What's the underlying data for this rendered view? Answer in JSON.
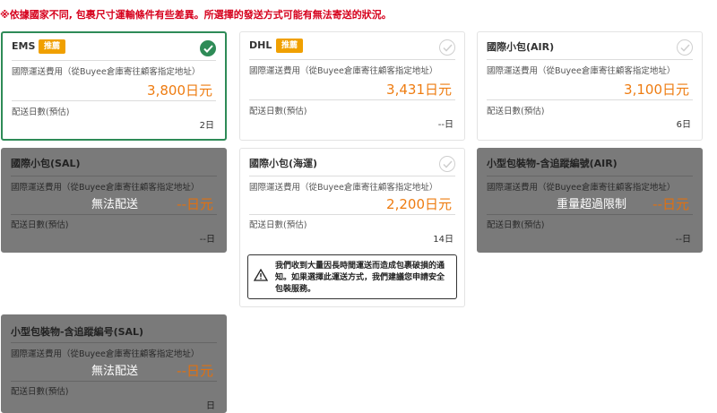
{
  "notice": "※依據國家不同, 包裹尺寸運輸條件有些差異。所選擇的發送方式可能有無法寄送的狀況。",
  "labels": {
    "cost": "國際運送費用（從Buyee倉庫寄往顧客指定地址）",
    "days": "配送日數(預估)"
  },
  "cards": [
    {
      "title": "EMS",
      "badge": "推薦",
      "price": "3,800日元",
      "days": "2日",
      "state": "selected"
    },
    {
      "title": "DHL",
      "badge": "推薦",
      "price": "3,431日元",
      "days": "--日",
      "state": "available"
    },
    {
      "title": "國際小包(AIR)",
      "price": "3,100日元",
      "days": "6日",
      "state": "available"
    },
    {
      "title": "國際小包(SAL)",
      "price": "--日元",
      "days": "--日",
      "status": "無法配送",
      "state": "disabled"
    },
    {
      "title": "國際小包(海運)",
      "price": "2,200日元",
      "days": "14日",
      "state": "available",
      "warning": "我們收到大量因長時間運送而造成包裹破損的通知。如果選擇此運送方式，我們建議您申請安全包裝服務。"
    },
    {
      "title": "小型包裝物-含追蹤編號(AIR)",
      "price": "--日元",
      "days": "--日",
      "status": "重量超過限制",
      "state": "disabled"
    },
    {
      "title": "小型包裝物-含追蹤編号(SAL)",
      "price": "--日元",
      "days": "日",
      "status": "無法配送",
      "state": "disabled"
    }
  ],
  "colors": {
    "accent": "#2e8b57",
    "price": "#ee7c11",
    "badge": "#f0a000",
    "notice": "#d6001c",
    "disabled": "#7a7a7a"
  },
  "icons": {
    "selected": "check-circle-icon",
    "unselected": "check-circle-outline-icon",
    "warning": "warning-triangle-icon"
  }
}
